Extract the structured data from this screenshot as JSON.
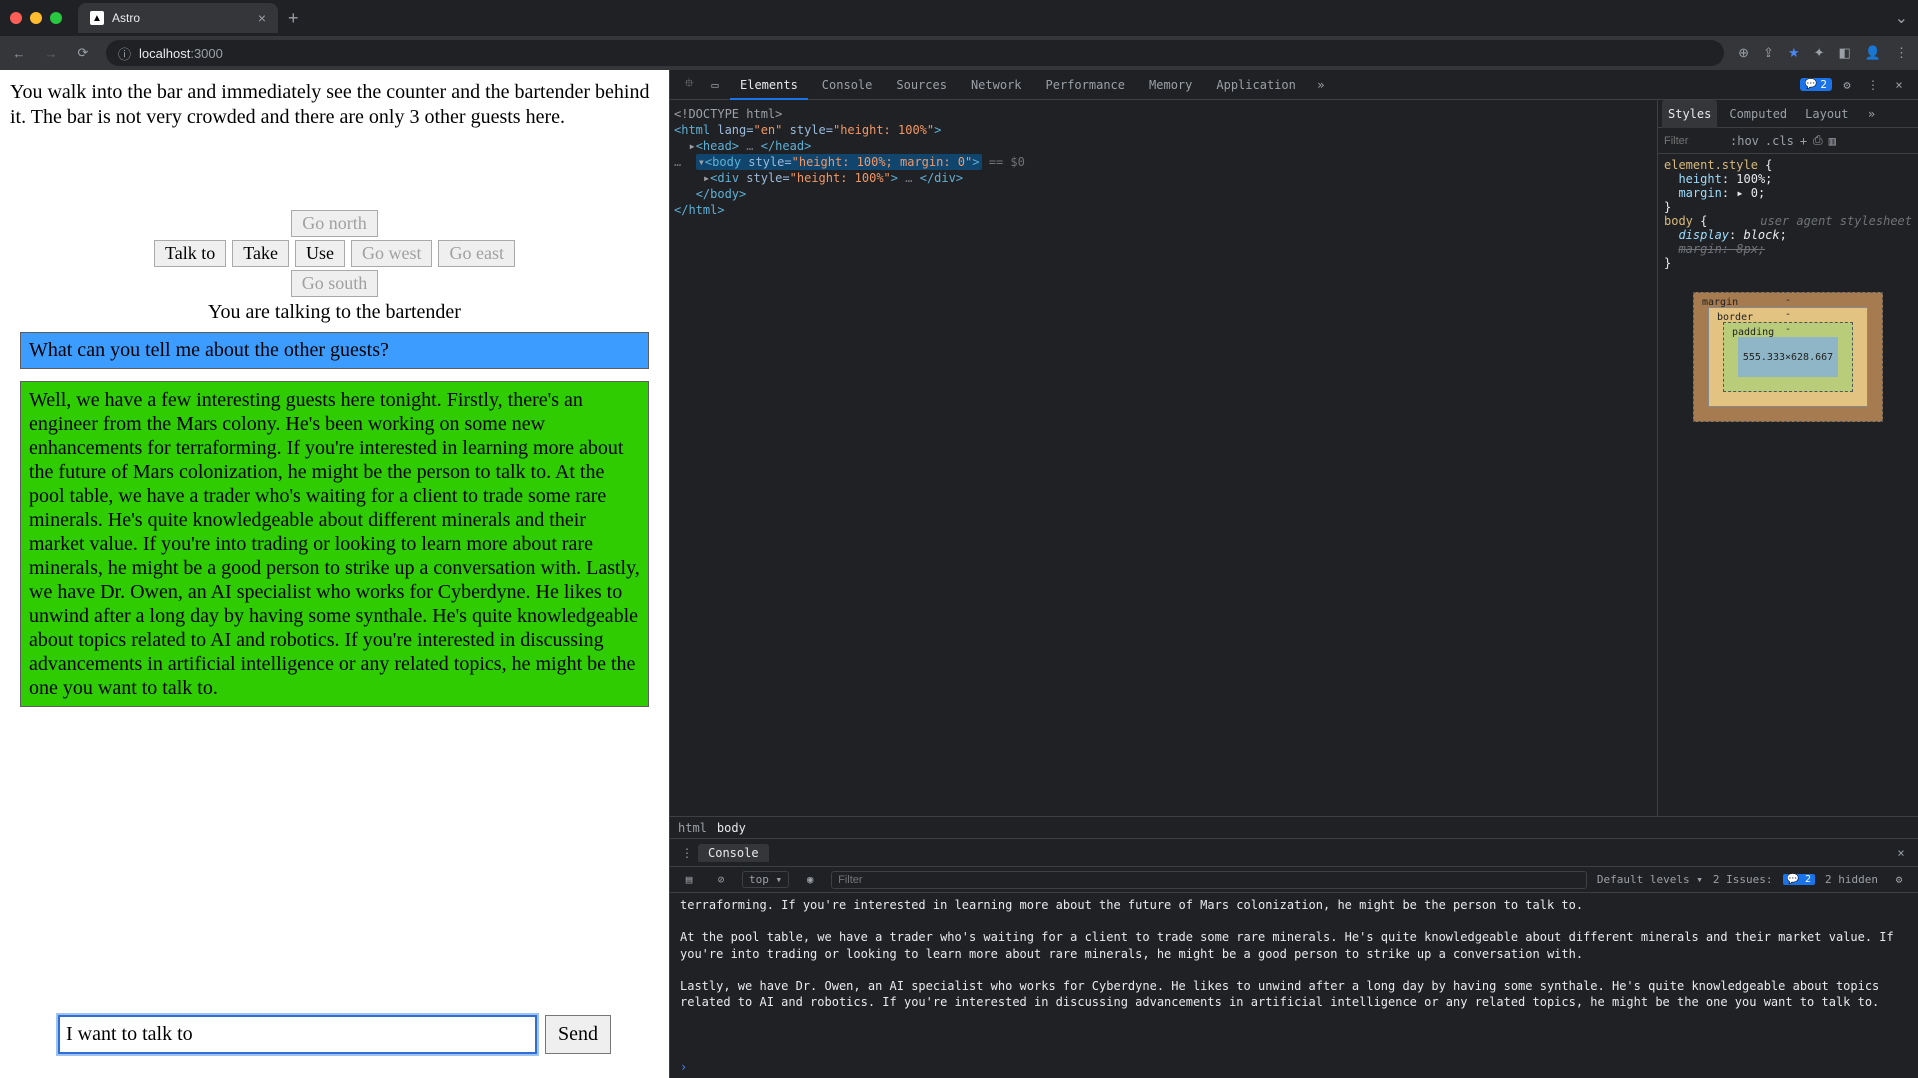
{
  "browser": {
    "tab_title": "Astro",
    "url_host": "localhost",
    "url_port": ":3000"
  },
  "page": {
    "narration": "You walk into the bar and immediately see the counter and the bartender behind it. The bar is not very crowded and there are only 3 other guests here.",
    "actions": {
      "talk": "Talk to",
      "take": "Take",
      "use": "Use",
      "north": "Go north",
      "west": "Go west",
      "east": "Go east",
      "south": "Go south"
    },
    "talking_to": "You are talking to the bartender",
    "question": "What can you tell me about the other guests?",
    "answer": "Well, we have a few interesting guests here tonight. Firstly, there's an engineer from the Mars colony. He's been working on some new enhancements for terraforming. If you're interested in learning more about the future of Mars colonization, he might be the person to talk to. At the pool table, we have a trader who's waiting for a client to trade some rare minerals. He's quite knowledgeable about different minerals and their market value. If you're into trading or looking to learn more about rare minerals, he might be a good person to strike up a conversation with. Lastly, we have Dr. Owen, an AI specialist who works for Cyberdyne. He likes to unwind after a long day by having some synthale. He's quite knowledgeable about topics related to AI and robotics. If you're interested in discussing advancements in artificial intelligence or any related topics, he might be the one you want to talk to.",
    "input_value": "I want to talk to ",
    "send_label": "Send"
  },
  "devtools": {
    "tabs": [
      "Elements",
      "Console",
      "Sources",
      "Network",
      "Performance",
      "Memory",
      "Application"
    ],
    "issues_count": "2",
    "styles_tabs": [
      "Styles",
      "Computed",
      "Layout"
    ],
    "styles_filter_placeholder": "Filter",
    "styles_toolbar": [
      ":hov",
      ".cls"
    ],
    "element_style_label": "element.style",
    "style_rules": {
      "height": "height: 100%;",
      "margin0": "margin: ▸ 0;",
      "body_sel": "body {",
      "display_block": "display: block;",
      "margin8": "margin: 8px;",
      "ua": "user agent stylesheet"
    },
    "boxmodel": {
      "margin": "margin",
      "border": "border",
      "padding": "padding",
      "size": "555.333×628.667"
    },
    "dom": {
      "doctype": "<!DOCTYPE html>",
      "html_open": "<html lang=\"en\" style=\"height: 100%\">",
      "head": "▸<head>…</head>",
      "body_open": "▾<body style=\"height: 100%; margin: 0\">",
      "body_suffix": " == $0",
      "div": "▸<div style=\"height: 100%\">…</div>",
      "body_close": "</body>",
      "html_close": "</html>"
    },
    "breadcrumb": [
      "html",
      "body"
    ]
  },
  "console": {
    "tab": "Console",
    "context": "top",
    "filter_placeholder": "Filter",
    "levels": "Default levels",
    "issues_label": "2 Issues:",
    "issues_count": "2",
    "hidden": "2 hidden",
    "log": "terraforming. If you're interested in learning more about the future of Mars colonization, he might be the person to talk to.\n\nAt the pool table, we have a trader who's waiting for a client to trade some rare minerals. He's quite knowledgeable about different minerals and their market value. If you're into trading or looking to learn more about rare minerals, he might be a good person to strike up a conversation with.\n\nLastly, we have Dr. Owen, an AI specialist who works for Cyberdyne. He likes to unwind after a long day by having some synthale. He's quite knowledgeable about topics related to AI and robotics. If you're interested in discussing advancements in artificial intelligence or any related topics, he might be the one you want to talk to.",
    "prompt": "›"
  }
}
